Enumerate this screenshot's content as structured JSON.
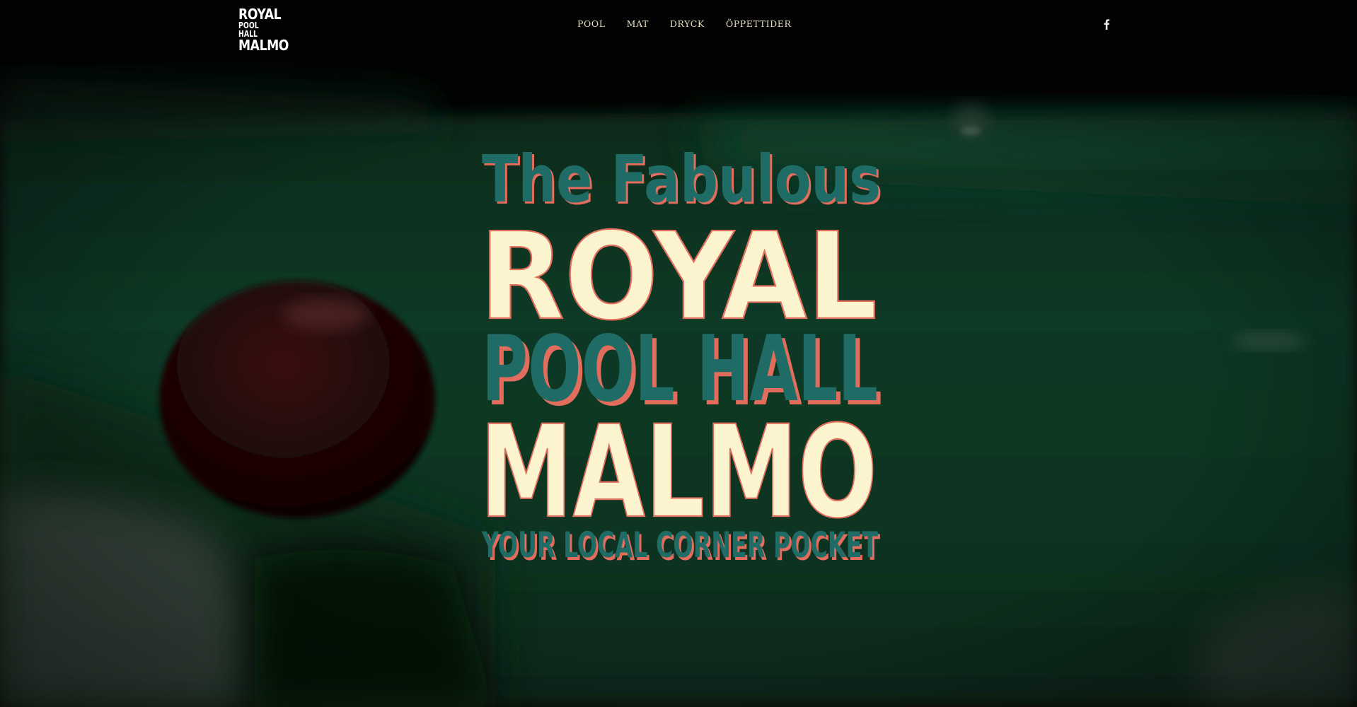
{
  "logo": {
    "line1": "ROYAL",
    "line2": "POOL HALL",
    "line3": "MALMO"
  },
  "nav": {
    "items": [
      {
        "label": "POOL"
      },
      {
        "label": "MAT"
      },
      {
        "label": "DRYCK"
      },
      {
        "label": "ÖPPETTIDER"
      }
    ]
  },
  "social": {
    "icon": "facebook-icon"
  },
  "hero": {
    "tagline_top": "The Fabulous",
    "title_royal": "ROYAL",
    "title_poolhall": "POOL HALL",
    "title_malmo": "MALMO",
    "tagline_bottom": "YOUR LOCAL CORNER POCKET"
  },
  "colors": {
    "teal": "#1f6b66",
    "cream": "#fbf4cf",
    "coral": "#e26d5c",
    "nav_text": "#e6dcc2",
    "felt": "#0f3b25"
  }
}
